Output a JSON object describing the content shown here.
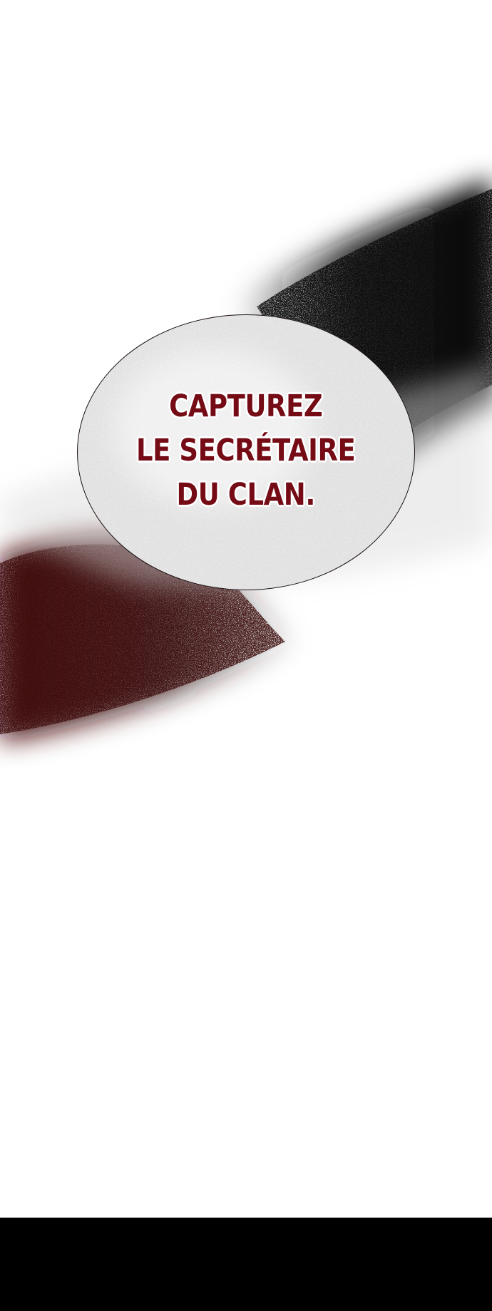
{
  "bubble": {
    "lines": [
      "CAPTUREZ",
      "LE SECRÉTAIRE",
      "DU CLAN."
    ]
  },
  "colors": {
    "background": "#ffffff",
    "text": "#740b15",
    "smoke_dark": "#111111",
    "smoke_red": "#5a0d0f",
    "bottom_band": "#000000"
  }
}
